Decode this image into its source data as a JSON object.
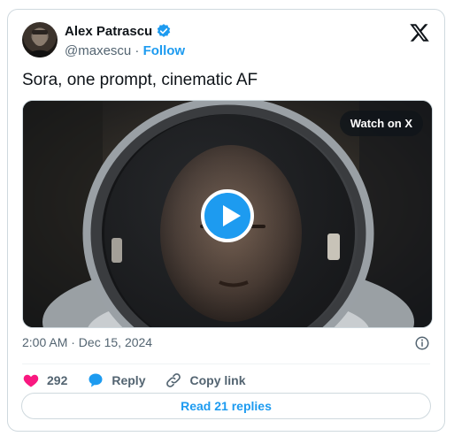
{
  "author": {
    "name": "Alex Patrascu",
    "handle": "@maxescu",
    "separator": "·",
    "follow_label": "Follow"
  },
  "icons": {
    "verified": "verified-badge-icon",
    "logo": "x-logo-icon",
    "play": "play-icon",
    "info": "info-icon",
    "like": "heart-icon",
    "reply": "reply-bubble-icon",
    "copy": "link-icon"
  },
  "colors": {
    "accent": "#1d9bf0",
    "like": "#f91880",
    "muted": "#536471"
  },
  "tweet": {
    "text": "Sora, one prompt, cinematic AF",
    "timestamp": "2:00 AM · Dec 15, 2024"
  },
  "media": {
    "watch_label": "Watch on X"
  },
  "actions": {
    "like_count": "292",
    "reply_label": "Reply",
    "copy_label": "Copy link"
  },
  "replies": {
    "label": "Read 21 replies"
  }
}
